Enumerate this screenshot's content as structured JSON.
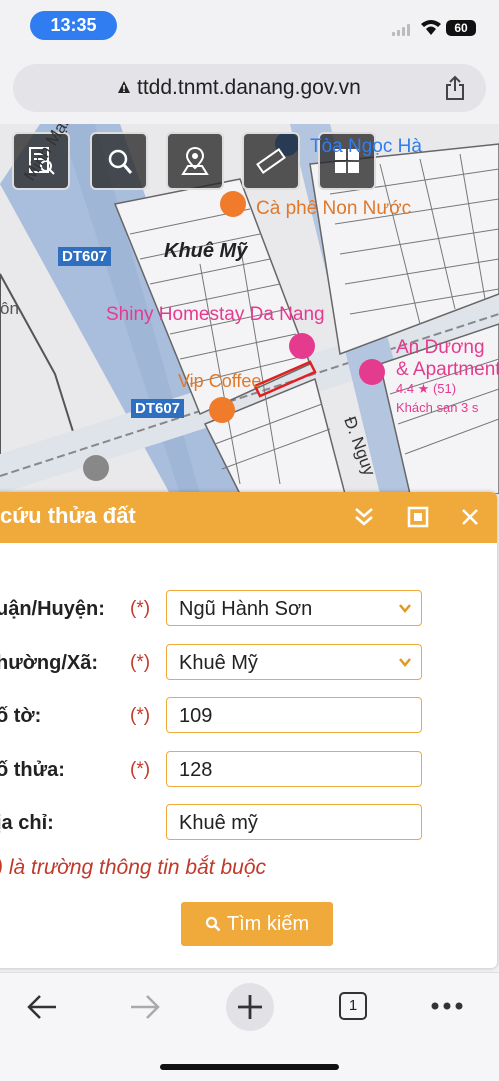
{
  "status_bar": {
    "time": "13:35",
    "battery": "60"
  },
  "browser": {
    "url": "ttdd.tnmt.danang.gov.vn",
    "tab_count": "1"
  },
  "map": {
    "labels": {
      "road_dt607_a": "DT607",
      "road_dt607_b": "DT607",
      "road_minh_mang": "Minh Mạng",
      "area_khue_my": "Khuê Mỹ",
      "poi_toa_ngoc_ha": "Tòa Ngọc Hà",
      "poi_ca_phe": "Cà phê Non Nước",
      "poi_shiny": "Shiny Homestay Da Nang",
      "poi_vip_coffee": "Vip Coffee",
      "poi_an_duong": "An Dương",
      "poi_apartment": "& Apartment",
      "poi_rating": "4.4 ★ (51)",
      "poi_hotel": "Khách sạn 3 s",
      "road_nguy": "Đ. Nguy",
      "left_an": "ôn"
    },
    "tools": [
      "search-parcel-tool",
      "zoom-search-tool",
      "location-tool",
      "measure-tool",
      "layers-tool"
    ]
  },
  "panel": {
    "title": "cứu thửa đất",
    "fields": [
      {
        "label": "uận/Huyện:",
        "required": "(*)",
        "value": "Ngũ Hành Sơn",
        "type": "select"
      },
      {
        "label": "hường/Xã:",
        "required": "(*)",
        "value": "Khuê Mỹ",
        "type": "select"
      },
      {
        "label": "ố tờ:",
        "required": "(*)",
        "value": "109",
        "type": "input"
      },
      {
        "label": "ố thửa:",
        "required": "(*)",
        "value": "128",
        "type": "input"
      },
      {
        "label": "ịa chỉ:",
        "required": "",
        "value": "Khuê mỹ",
        "type": "input"
      }
    ],
    "note": ") là trường thông tin bắt buộc",
    "search_button": "Tìm kiếm"
  },
  "colors": {
    "accent": "#f0aa3b",
    "required": "#c0392b",
    "status_pill": "#2f7df0"
  }
}
